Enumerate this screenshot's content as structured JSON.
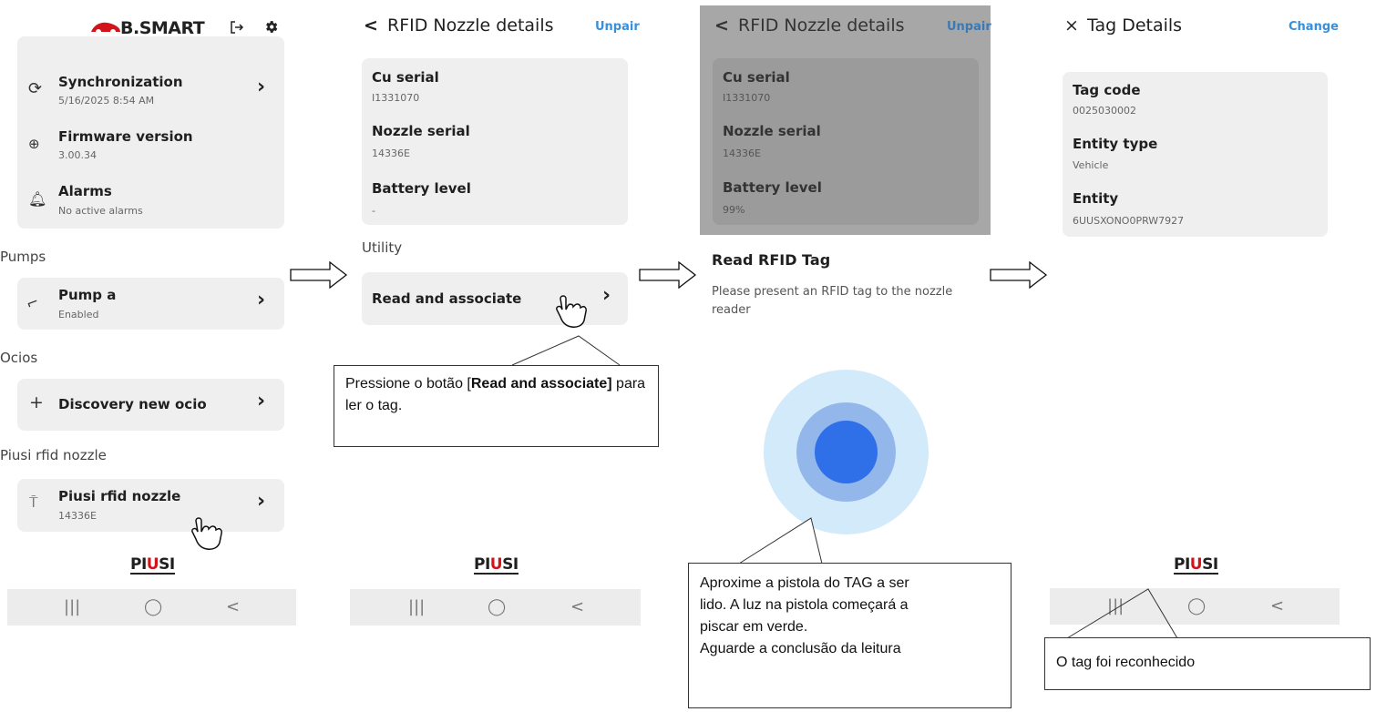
{
  "screen1": {
    "brand": "B.SMART",
    "items": [
      {
        "title": "Synchronization",
        "sub": "5/16/2025 8:54 AM"
      },
      {
        "title": "Firmware version",
        "sub": "3.00.34"
      },
      {
        "title": "Alarms",
        "sub": "No active alarms"
      }
    ],
    "section_pumps": "Pumps",
    "pump": {
      "title": "Pump a",
      "sub": "Enabled"
    },
    "section_ocios": "Ocios",
    "ocio": {
      "icon": "+",
      "title": "Discovery new ocio"
    },
    "section_nozzle": "Piusi rfid nozzle",
    "nozzle": {
      "title": "Piusi rfid nozzle",
      "sub": "14336E"
    }
  },
  "screen2": {
    "back": "<",
    "title": "RFID Nozzle details",
    "action": "Unpair",
    "fields": [
      {
        "title": "Cu serial",
        "sub": "I1331070"
      },
      {
        "title": "Nozzle serial",
        "sub": "14336E"
      },
      {
        "title": "Battery level",
        "sub": "-"
      }
    ],
    "section_utility": "Utility",
    "read_button": "Read and associate"
  },
  "screen3": {
    "back": "<",
    "title": "RFID Nozzle details",
    "action": "Unpair",
    "fields": [
      {
        "title": "Cu serial",
        "sub": "I1331070"
      },
      {
        "title": "Nozzle serial",
        "sub": "14336E"
      },
      {
        "title": "Battery level",
        "sub": "99%"
      }
    ],
    "sheet_title": "Read RFID Tag",
    "sheet_text": "Please present an RFID tag to the nozzle reader"
  },
  "screen4": {
    "close": "×",
    "title": "Tag Details",
    "action": "Change",
    "fields": [
      {
        "title": "Tag code",
        "sub": "0025030002"
      },
      {
        "title": "Entity type",
        "sub": "Vehicle"
      },
      {
        "title": "Entity",
        "sub": "6UUSXONO0PRW7927"
      }
    ]
  },
  "logo": {
    "pre": "PI",
    "u": "U",
    "post": "SI"
  },
  "nav": {
    "recent": "|||",
    "home": "◯",
    "back": "<"
  },
  "callouts": {
    "c1_pre": "Pressione o botão [",
    "c1_bold": "Read and associate]",
    "c1_post": " para ler o tag.",
    "c2_l1": "Aproxime a pistola do TAG a ser",
    "c2_l2": "lido. A luz na pistola começará a",
    "c2_l3": "piscar em verde.",
    "c2_l4": "Aguarde a conclusão da leitura",
    "c3": "O tag foi reconhecido"
  },
  "colors": {
    "accent": "#3a8fd9",
    "brand_red": "#d2141a",
    "card": "#efefef",
    "pulse_inner": "#2f6fe8"
  }
}
